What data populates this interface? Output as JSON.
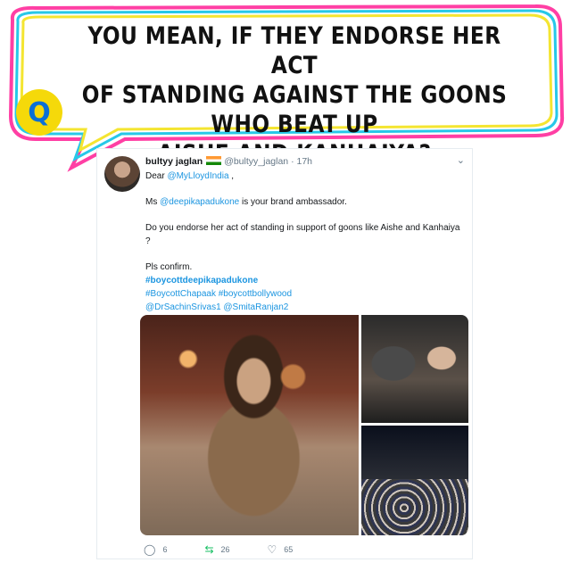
{
  "header": {
    "line1": "YOU MEAN, IF THEY ENDORSE HER ACT",
    "line2": "OF STANDING AGAINST THE GOONS WHO BEAT UP",
    "line3": "AISHE AND KANHAIYA?",
    "logo_letter": "Q"
  },
  "tweet": {
    "name": "bultyy jaglan",
    "handle": "@bultyy_jaglan",
    "sep": "·",
    "time": "17h",
    "chevron": "⌄",
    "body": {
      "dear_prefix": "Dear ",
      "dear_mention": "@MyLloydIndia",
      "dear_suffix": " ,",
      "ms_prefix": "Ms ",
      "ms_mention": "@deepikapadukone",
      "ms_suffix": " is your brand ambassador.",
      "question": "Do you endorse her act of standing in support of goons like Aishe and Kanhaiya ?",
      "confirm": "Pls confirm.",
      "hashtag1": "#boycottdeepikapadukone",
      "hashtag2": "#BoycottChapaak",
      "hashtag3": "#boycottbollywood",
      "mention1": "@DrSachinSrivas1",
      "mention2": "@SmitaRanjan2"
    },
    "actions": {
      "replies": "6",
      "retweets": "26",
      "likes": "65"
    },
    "colors": {
      "link": "#1b95e0",
      "muted": "#657786",
      "text": "#14171a"
    }
  }
}
